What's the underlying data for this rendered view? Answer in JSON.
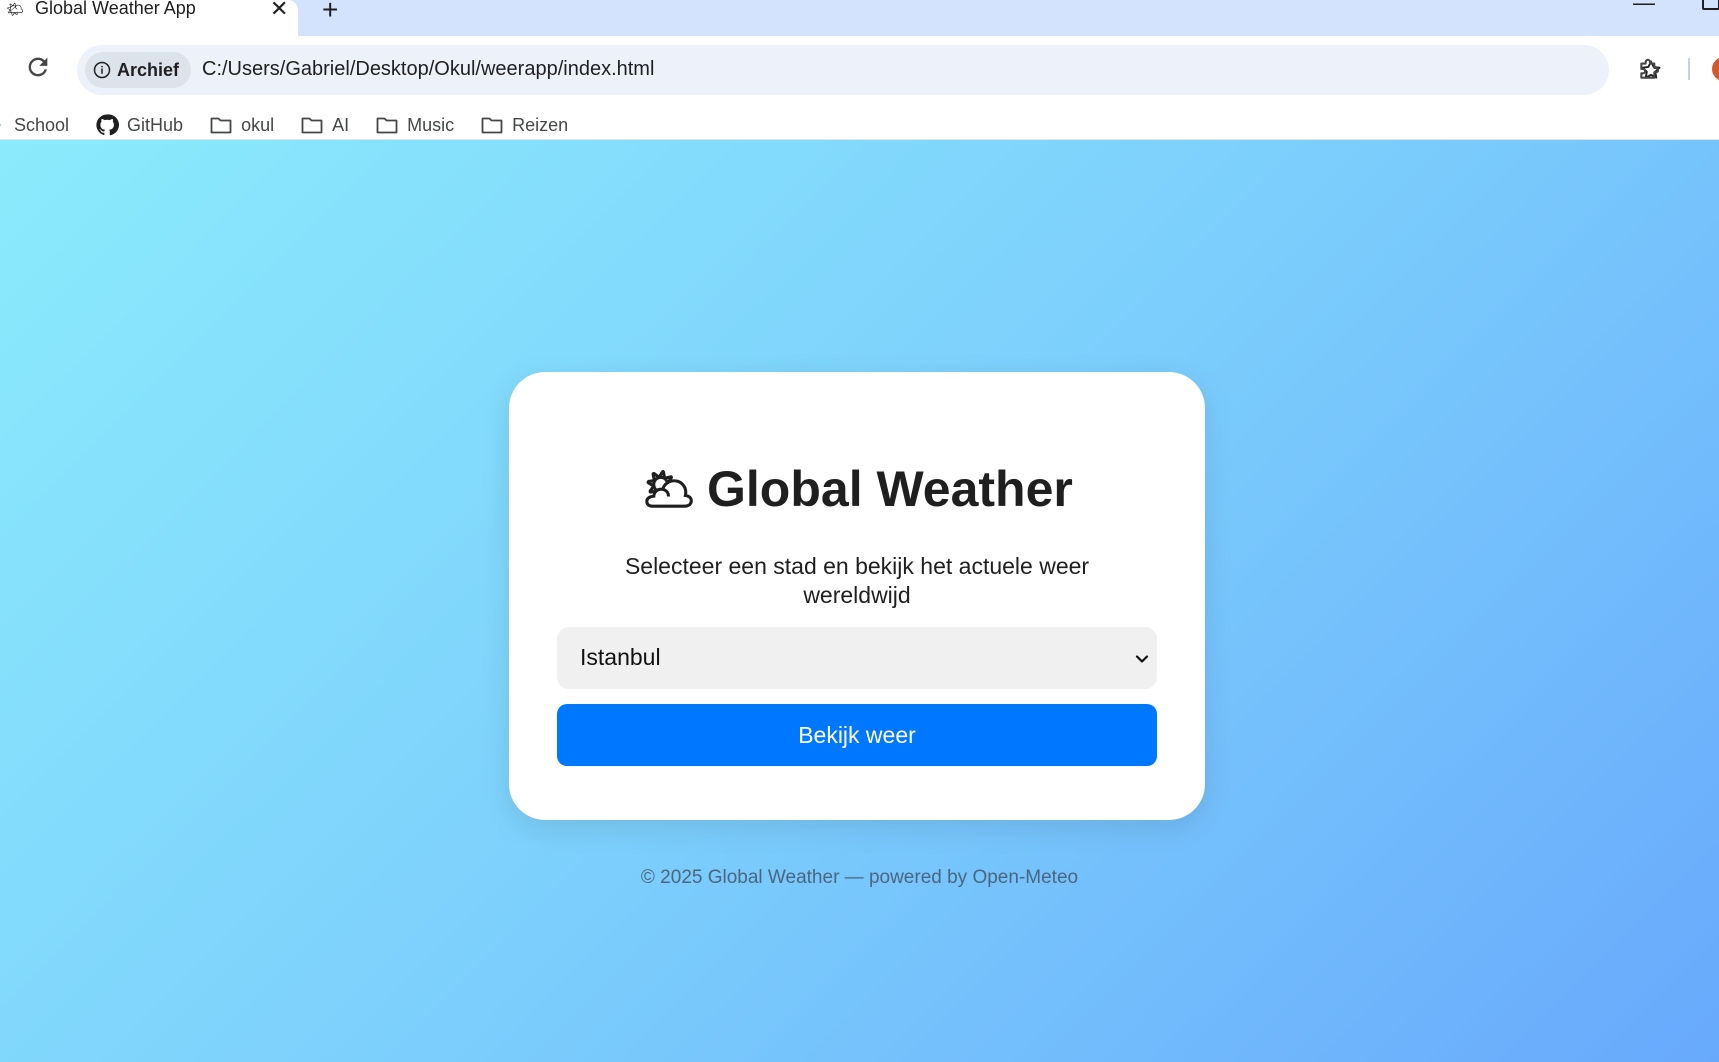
{
  "browser": {
    "tab_title": "Global Weather App",
    "tab_close": "✕",
    "new_tab": "+",
    "minimize": "—",
    "site_chip_label": "Archief",
    "url": "C:/Users/Gabriel/Desktop/Okul/weerapp/index.html"
  },
  "bookmarks": {
    "items": [
      "School",
      "GitHub",
      "okul",
      "AI",
      "Music",
      "Reizen"
    ]
  },
  "card": {
    "emoji": "🌥",
    "title": "Global Weather",
    "subtitle": "Selecteer een stad en bekijk het actuele weer wereldwijd",
    "select_value": "Istanbul",
    "button_label": "Bekijk weer"
  },
  "footer": {
    "text": "© 2025 Global Weather — powered by Open-Meteo"
  },
  "colors": {
    "accent": "#0077ff",
    "gradient_start": "#8bebfc",
    "gradient_end": "#68a9fc",
    "tabstrip": "#d3e3fd"
  }
}
